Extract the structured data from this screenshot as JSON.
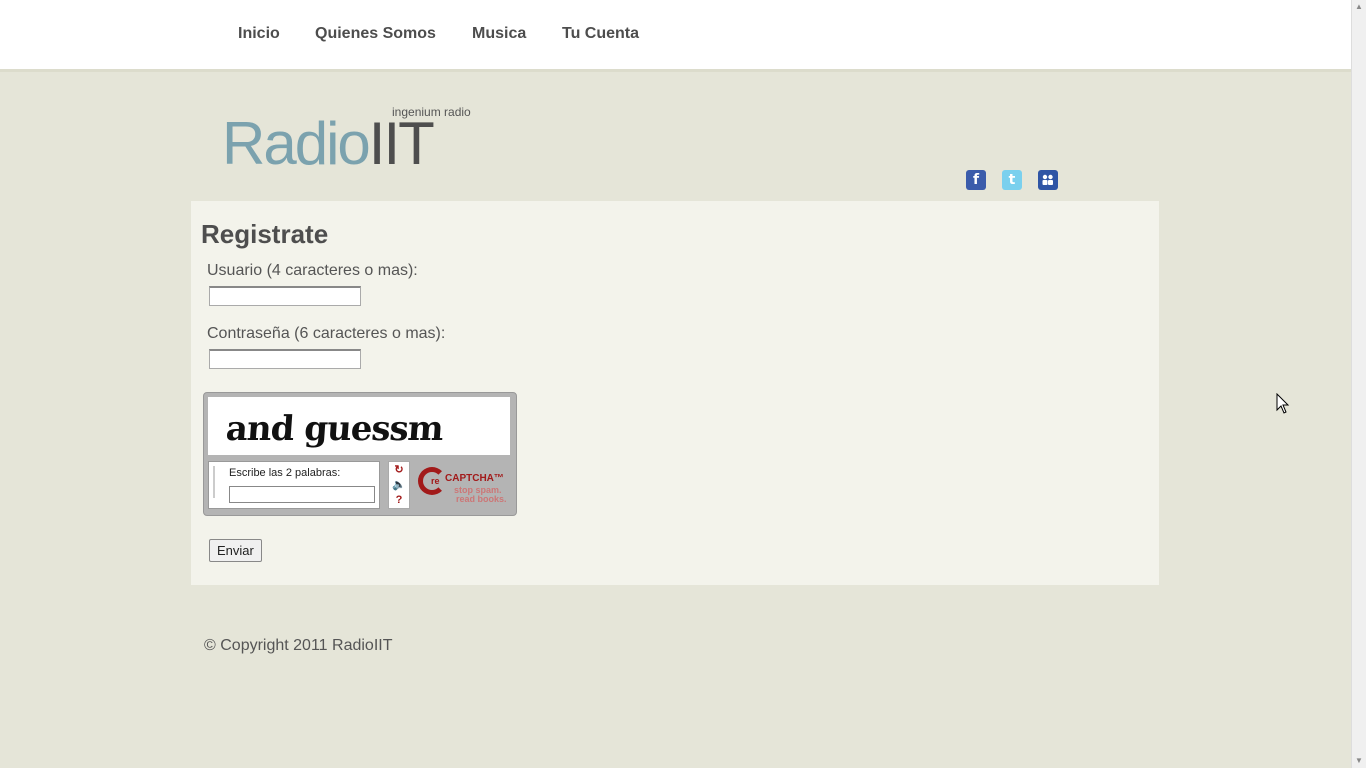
{
  "nav": {
    "items": [
      {
        "label": "Inicio"
      },
      {
        "label": "Quienes Somos"
      },
      {
        "label": "Musica"
      },
      {
        "label": "Tu Cuenta"
      }
    ]
  },
  "header": {
    "tagline": "ingenium radio",
    "logo_part1": "Radio",
    "logo_part2": "IIT",
    "social_icons": [
      "facebook-icon",
      "twitter-icon",
      "myspace-icon"
    ]
  },
  "form": {
    "title": "Registrate",
    "username_label": "Usuario (4 caracteres o mas):",
    "username_value": "",
    "password_label": "Contraseña (6 caracteres o mas):",
    "password_value": "",
    "captcha": {
      "challenge_text": "and guessm",
      "prompt": "Escribe las 2 palabras:",
      "input_value": "",
      "logo_text": "CAPTCHA™",
      "slogan1": "stop spam.",
      "slogan2": "read books."
    },
    "submit_label": "Enviar"
  },
  "footer": {
    "copyright": "© Copyright 2011 RadioIIT"
  },
  "colors": {
    "background": "#e5e5d8",
    "panel": "#f3f3eb",
    "logo_radio": "#7ba2ae",
    "logo_iit": "#4e4e4e"
  }
}
